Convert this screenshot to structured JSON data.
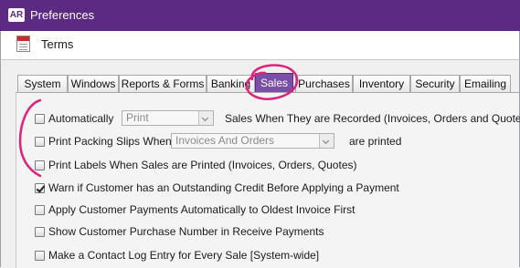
{
  "window": {
    "app_badge": "AR",
    "title": "Preferences"
  },
  "subheader": {
    "label": "Terms",
    "icon": "terms-document-icon"
  },
  "tabs": [
    {
      "label": "System",
      "active": false
    },
    {
      "label": "Windows",
      "active": false
    },
    {
      "label": "Reports & Forms",
      "active": false
    },
    {
      "label": "Banking",
      "active": false
    },
    {
      "label": "Sales",
      "active": true
    },
    {
      "label": "Purchases",
      "active": false
    },
    {
      "label": "Inventory",
      "active": false
    },
    {
      "label": "Security",
      "active": false
    },
    {
      "label": "Emailing",
      "active": false
    }
  ],
  "options": {
    "auto_print": {
      "checked": false,
      "label": "Automatically",
      "select_value": "Print",
      "suffix": "Sales When They are Recorded (Invoices, Orders and Quotes)"
    },
    "packing_slips": {
      "checked": false,
      "label": "Print Packing Slips When",
      "select_value": "Invoices And Orders",
      "suffix": "are printed"
    },
    "print_labels": {
      "checked": false,
      "label": "Print Labels When Sales are Printed (Invoices, Orders, Quotes)"
    },
    "warn_credit": {
      "checked": true,
      "label": "Warn if Customer has an Outstanding Credit Before Applying a Payment"
    },
    "apply_oldest": {
      "checked": false,
      "label": "Apply Customer Payments Automatically to Oldest Invoice First"
    },
    "show_po": {
      "checked": false,
      "label": "Show Customer Purchase Number in Receive Payments"
    },
    "contact_log": {
      "checked": false,
      "label": "Make a Contact Log Entry for Every Sale [System-wide]"
    }
  },
  "colors": {
    "title_bar": "#5c2a83",
    "active_tab": "#7a4fa8",
    "annotation": "#e0207a"
  }
}
